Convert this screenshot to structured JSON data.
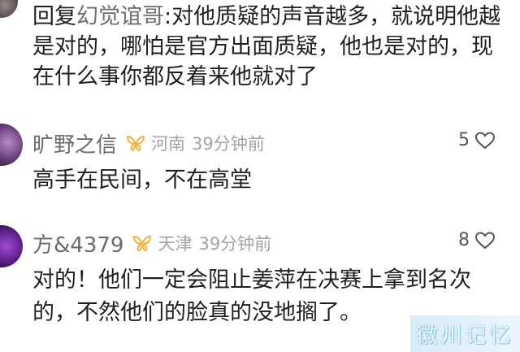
{
  "reply": {
    "prefix": "回复",
    "target_name": "幻觉谊哥",
    "text": ":对他质疑的声音越多，就说明他越是对的，哪怕是官方出面质疑，他也是对的，现在什么事你都反着来他就对了"
  },
  "comments": [
    {
      "username": "旷野之信",
      "badge_icon": "gold-ribbon-icon",
      "location": "河南",
      "time": "39分钟前",
      "likes": "5",
      "text": "高手在民间，不在高堂"
    },
    {
      "username": "方&4379",
      "badge_icon": "gold-ribbon-icon",
      "location": "天津",
      "time": "39分钟前",
      "likes": "8",
      "text": "对的！他们一定会阻止姜萍在决赛上拿到名次的，不然他们的脸真的没地搁了。"
    }
  ],
  "watermark": {
    "text": "徽州记忆"
  },
  "colors": {
    "badge": "#f0b74a",
    "meta": "#a3a3a3",
    "username": "#6b6b6b"
  }
}
